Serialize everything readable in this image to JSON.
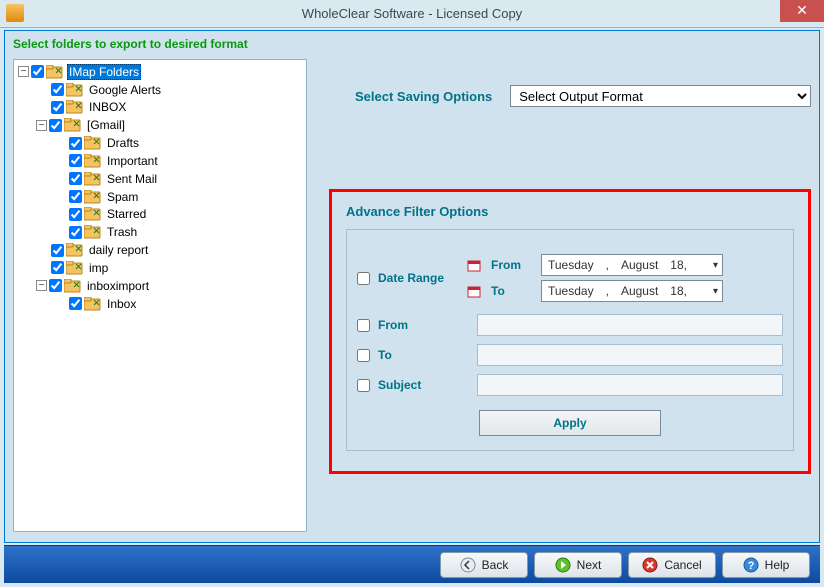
{
  "title": "WholeClear Software - Licensed Copy",
  "instruction": "Select folders to export to desired format",
  "tree": {
    "root": {
      "label": "IMap Folders",
      "selected": true
    },
    "lvl1": [
      {
        "label": "Google Alerts"
      },
      {
        "label": "INBOX"
      },
      {
        "label": "[Gmail]",
        "expandable": true,
        "children": [
          {
            "label": "Drafts"
          },
          {
            "label": "Important"
          },
          {
            "label": "Sent Mail"
          },
          {
            "label": "Spam"
          },
          {
            "label": "Starred"
          },
          {
            "label": "Trash"
          }
        ]
      },
      {
        "label": "daily report"
      },
      {
        "label": "imp"
      },
      {
        "label": "inboximport",
        "expandable": true,
        "children": [
          {
            "label": "Inbox"
          }
        ]
      }
    ]
  },
  "saving": {
    "label": "Select Saving Options",
    "placeholder": "Select Output Format"
  },
  "filter": {
    "title": "Advance Filter Options",
    "date_range_label": "Date Range",
    "from_label": "From",
    "to_label": "To",
    "subject_label": "Subject",
    "apply_label": "Apply",
    "date_from": {
      "dow": "Tuesday",
      "sep": ",",
      "month": "August",
      "day": "18,"
    },
    "date_to": {
      "dow": "Tuesday",
      "sep": ",",
      "month": "August",
      "day": "18,"
    }
  },
  "footer": {
    "back": "Back",
    "next": "Next",
    "cancel": "Cancel",
    "help": "Help"
  }
}
